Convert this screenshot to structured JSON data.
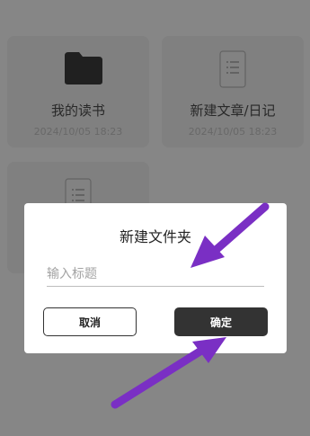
{
  "background_cards": [
    {
      "name": "我的读书",
      "date": "2024/10/05 18:23",
      "icon": "folder-icon"
    },
    {
      "name": "新建文章/日记",
      "date": "2024/10/05 18:23",
      "icon": "document-icon"
    },
    {
      "name": "",
      "date": "",
      "icon": "document-icon"
    }
  ],
  "dialog": {
    "title": "新建文件夹",
    "input_placeholder": "输入标题",
    "input_value": "",
    "cancel_label": "取消",
    "confirm_label": "确定"
  },
  "colors": {
    "overlay": "#8f8f8f",
    "dialog_bg": "#ffffff",
    "confirm_bg": "#333333",
    "annotation_arrow": "#7a2fc4"
  }
}
